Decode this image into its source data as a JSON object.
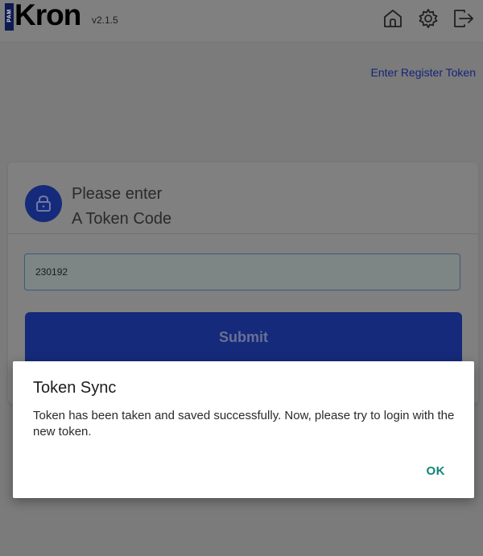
{
  "header": {
    "logo_badge": "PAM",
    "logo_text": "Kron",
    "version": "v2.1.5",
    "icons": [
      "home-icon",
      "gear-icon",
      "logout-icon"
    ]
  },
  "register_link": "Enter Register Token",
  "card": {
    "title_line1": "Please enter",
    "title_line2": "A Token Code",
    "token_value": "230192",
    "submit_label": "Submit",
    "icon": "lock-icon"
  },
  "dialog": {
    "title": "Token Sync",
    "message": "Token has been taken and saved successfully. Now, please try to login with the new token.",
    "ok_label": "OK"
  },
  "colors": {
    "brand_blue": "#1e3a9c",
    "accent_teal": "#0b8577",
    "overlay": "#7b7b7b"
  }
}
